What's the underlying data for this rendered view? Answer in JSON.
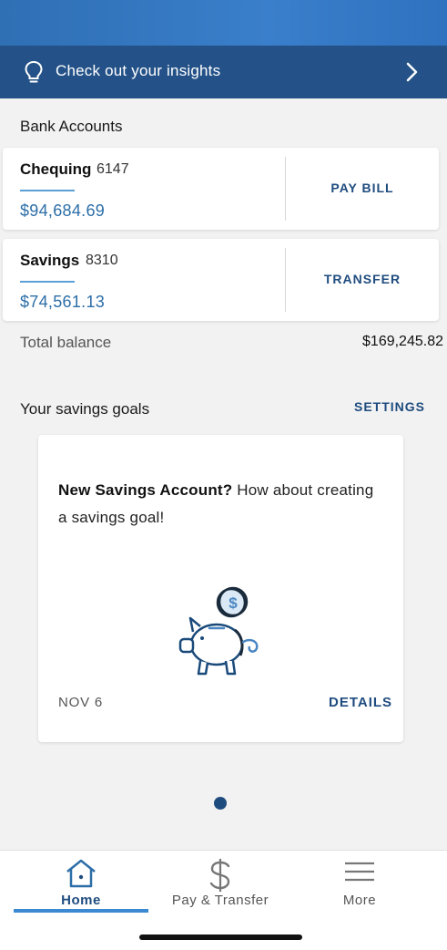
{
  "insights_banner": {
    "label": "Check out your insights",
    "icon": "lightbulb-icon",
    "chevron": "chevron-right-icon"
  },
  "bank_accounts": {
    "title": "Bank Accounts",
    "accounts": [
      {
        "name": "Chequing",
        "number": "6147",
        "balance": "$94,684.69",
        "action": "PAY BILL"
      },
      {
        "name": "Savings",
        "number": "8310",
        "balance": "$74,561.13",
        "action": "TRANSFER"
      }
    ],
    "total_label": "Total balance",
    "total_value": "$169,245.82"
  },
  "savings_goals": {
    "title": "Your savings goals",
    "settings_label": "SETTINGS",
    "card": {
      "headline": "New Savings Account?",
      "message": " How about creating a savings goal!",
      "illustration": "piggy-bank-icon",
      "date": "NOV 6",
      "details_label": "DETAILS"
    }
  },
  "tabs": [
    {
      "label": "Home",
      "icon": "home-icon",
      "active": true
    },
    {
      "label": "Pay & Transfer",
      "icon": "dollar-icon",
      "active": false
    },
    {
      "label": "More",
      "icon": "menu-icon",
      "active": false
    }
  ],
  "colors": {
    "accent": "#1f4c7f",
    "banner": "#245288",
    "balance": "#2c6ea8"
  }
}
